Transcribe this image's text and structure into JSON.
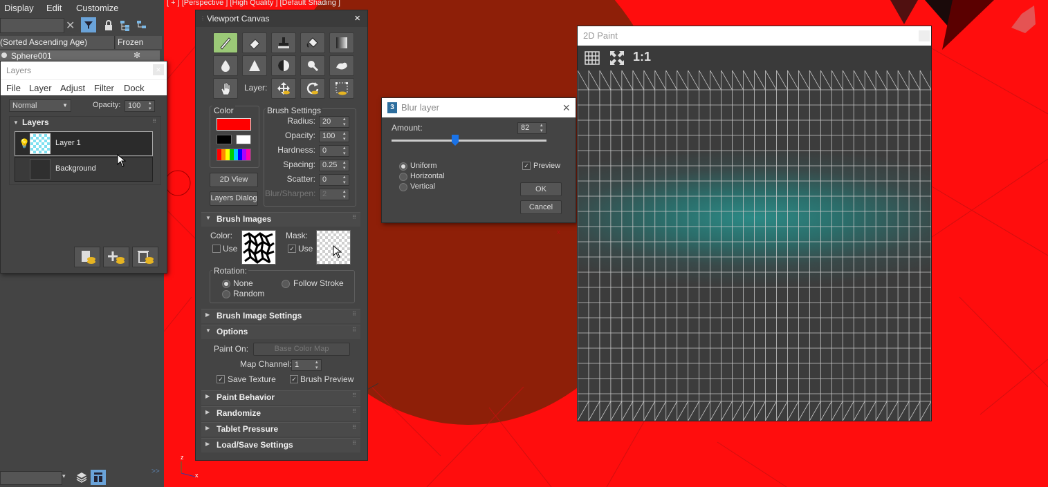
{
  "scene_panel": {
    "menu": [
      "Display",
      "Edit",
      "Customize"
    ],
    "sort_header": "(Sorted Ascending Age)",
    "frozen_header": "Frozen",
    "row_name": "Sphere001",
    "row_frozen": "✻"
  },
  "layers_window": {
    "title": "Layers",
    "close": "×",
    "menu": [
      "File",
      "Layer",
      "Adjust",
      "Filter",
      "Dock"
    ],
    "blend_mode": "Normal",
    "opacity_label": "Opacity:",
    "opacity_value": "100",
    "rollout_title": "Layers",
    "layers": [
      "Layer 1",
      "Background"
    ]
  },
  "viewport": {
    "label": "[ + ] [Perspective ] [High Quality ] [Default Shading ]",
    "axis_z": "z",
    "axis_x": "x",
    "stray_x": "x"
  },
  "viewport_canvas": {
    "title": "Viewport Canvas",
    "close": "×",
    "layer_label": "Layer:",
    "color_title": "Color",
    "primary_color": "#ff0000",
    "brush_settings_title": "Brush Settings",
    "brush_settings": [
      {
        "label": "Radius:",
        "value": "20"
      },
      {
        "label": "Opacity:",
        "value": "100"
      },
      {
        "label": "Hardness:",
        "value": "0"
      },
      {
        "label": "Spacing:",
        "value": "0.25"
      },
      {
        "label": "Scatter:",
        "value": "0"
      },
      {
        "label": "Blur/Sharpen:",
        "value": "2"
      }
    ],
    "view_2d_button": "2D View",
    "layers_dialog_button": "Layers Dialog",
    "brush_images_title": "Brush Images",
    "color_label": "Color:",
    "use_label": "Use",
    "mask_label": "Mask:",
    "mask_use_label": "Use",
    "rotation_label": "Rotation:",
    "rotation_options": [
      "None",
      "Follow Stroke",
      "Random"
    ],
    "brush_image_settings_title": "Brush Image Settings",
    "options_title": "Options",
    "paint_on_label": "Paint On:",
    "paint_on_value": "Base Color Map",
    "map_channel_label": "Map Channel:",
    "map_channel_value": "1",
    "save_texture_label": "Save Texture",
    "brush_preview_label": "Brush Preview",
    "collapsed_rollouts": [
      "Paint Behavior",
      "Randomize",
      "Tablet Pressure",
      "Load/Save Settings"
    ]
  },
  "blur_dialog": {
    "title": "Blur layer",
    "app_badge": "3",
    "close": "×",
    "amount_label": "Amount:",
    "amount_value": "82",
    "amount_fraction": 0.41,
    "options": [
      "Uniform",
      "Horizontal",
      "Vertical"
    ],
    "preview_label": "Preview",
    "ok_button": "OK",
    "cancel_button": "Cancel"
  },
  "paint_2d": {
    "title": "2D Paint",
    "zoom_label": "1:1"
  },
  "bottom_bar": {
    "expand": ">>"
  }
}
